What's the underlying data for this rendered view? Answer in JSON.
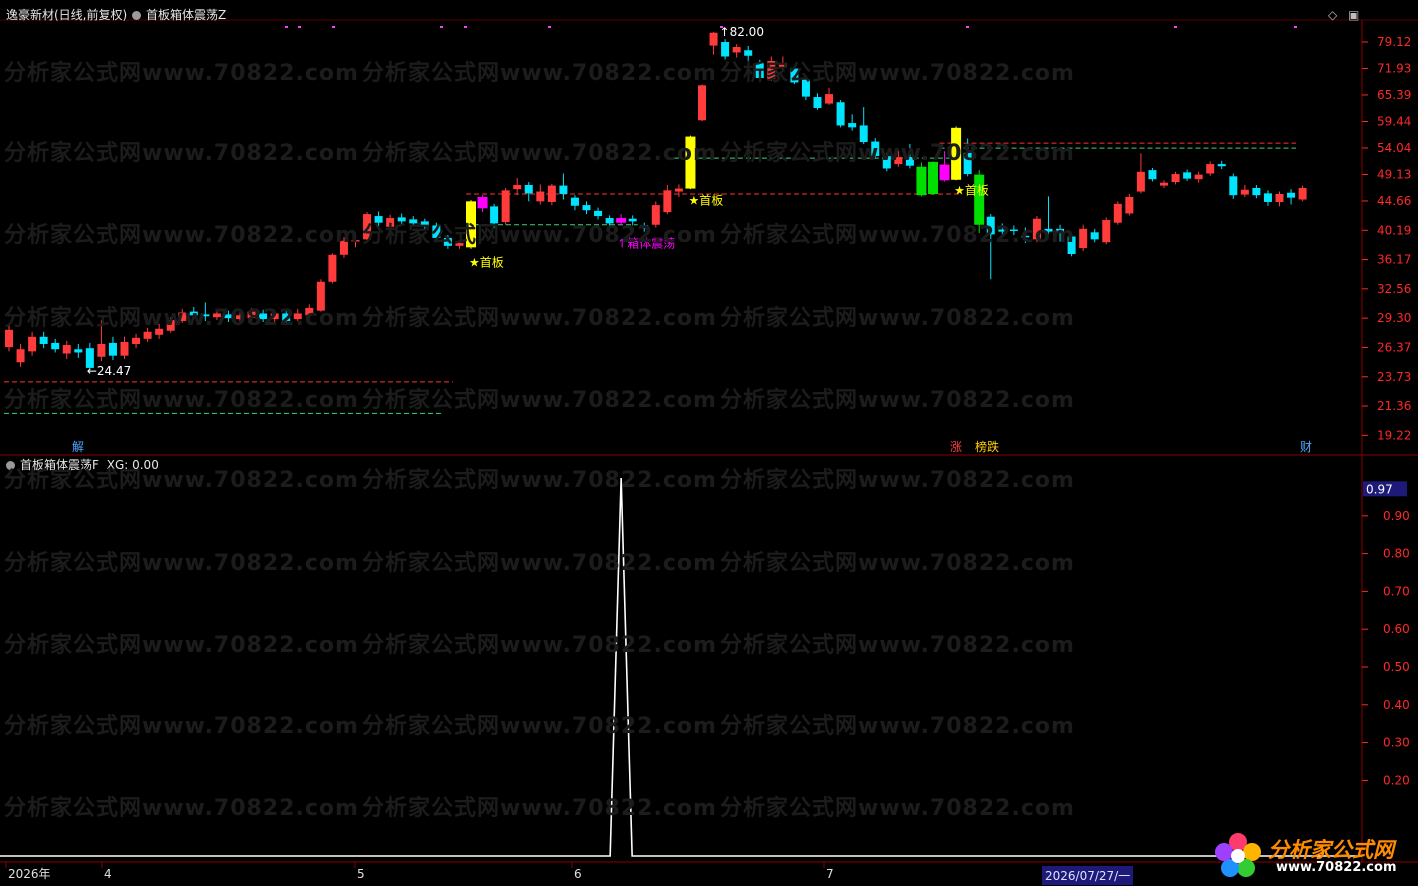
{
  "main_header": {
    "stock": "逸豪新材(日线,前复权)",
    "indicator": "首板箱体震荡Z"
  },
  "sub_header": {
    "indicator": "首板箱体震荡F",
    "xg_value": "XG: 0.00"
  },
  "window_controls": {
    "restore": "◇",
    "maximize": "▣"
  },
  "colors": {
    "up": "#ff3b3b",
    "down": "#00e5ff",
    "first_board": "#ffff00",
    "box_signal": "#ff00ff",
    "green_bar": "#00e000",
    "red_dash": "#ff3030",
    "green_dash": "#3cd37a",
    "axis_text": "#ff2828",
    "grid": "#600000"
  },
  "price_axis_labels": [
    "79.12",
    "71.93",
    "65.39",
    "59.44",
    "54.04",
    "49.13",
    "44.66",
    "40.19",
    "36.17",
    "32.56",
    "29.30",
    "26.37",
    "23.73",
    "21.36",
    "19.22"
  ],
  "sub_axis_labels": [
    "0.90",
    "0.80",
    "0.70",
    "0.60",
    "0.50",
    "0.40",
    "0.30",
    "0.20"
  ],
  "sub_axis_current": "0.97",
  "date_labels": [
    "2026年",
    "4",
    "5",
    "6",
    "7"
  ],
  "cursor_date": "2026/07/27/一",
  "annotations": {
    "high_price": "82.00",
    "low_price": "24.47",
    "first_board_1": "★首板",
    "first_board_2": "★首板",
    "first_board_3": "★首板",
    "box_osc": "箱体震荡"
  },
  "event_markers": {
    "jie": "解",
    "zhang": "涨",
    "bang_die": "榜跌",
    "cai": "财"
  },
  "watermark": "分析家公式网www.70822.com",
  "logo": {
    "title": "分析家公式网",
    "url": "www.70822.com"
  },
  "chart_data": {
    "type": "candlestick",
    "price_range": [
      19.22,
      82.0
    ],
    "candles": [
      {
        "o": 26.4,
        "c": 28.1,
        "h": 28.6,
        "l": 26.0
      },
      {
        "o": 25.0,
        "c": 26.2,
        "h": 26.7,
        "l": 24.6
      },
      {
        "o": 26.0,
        "c": 27.4,
        "h": 27.9,
        "l": 25.6
      },
      {
        "o": 27.4,
        "c": 26.7,
        "h": 27.9,
        "l": 26.3
      },
      {
        "o": 26.8,
        "c": 26.2,
        "h": 27.2,
        "l": 25.9
      },
      {
        "o": 25.8,
        "c": 26.6,
        "h": 27.0,
        "l": 25.3
      },
      {
        "o": 26.2,
        "c": 25.9,
        "h": 26.7,
        "l": 25.4
      },
      {
        "o": 26.3,
        "c": 24.5,
        "h": 26.8,
        "l": 24.3
      },
      {
        "o": 25.5,
        "c": 26.7,
        "h": 29.1,
        "l": 25.1
      },
      {
        "o": 26.8,
        "c": 25.6,
        "h": 27.4,
        "l": 25.2
      },
      {
        "o": 25.6,
        "c": 26.9,
        "h": 27.4,
        "l": 25.3
      },
      {
        "o": 26.7,
        "c": 27.3,
        "h": 27.7,
        "l": 26.3
      },
      {
        "o": 27.2,
        "c": 27.9,
        "h": 28.3,
        "l": 26.9
      },
      {
        "o": 27.6,
        "c": 28.2,
        "h": 28.7,
        "l": 27.2
      },
      {
        "o": 28.0,
        "c": 29.1,
        "h": 29.4,
        "l": 27.8
      },
      {
        "o": 29.0,
        "c": 29.9,
        "h": 30.3,
        "l": 28.8
      },
      {
        "o": 30.0,
        "c": 29.6,
        "h": 30.5,
        "l": 29.2
      },
      {
        "o": 29.7,
        "c": 29.5,
        "h": 31.0,
        "l": 29.0
      },
      {
        "o": 29.4,
        "c": 29.8,
        "h": 30.2,
        "l": 29.1
      },
      {
        "o": 29.7,
        "c": 29.3,
        "h": 30.1,
        "l": 28.9
      },
      {
        "o": 29.2,
        "c": 29.6,
        "h": 29.9,
        "l": 28.9
      },
      {
        "o": 29.3,
        "c": 30.0,
        "h": 30.4,
        "l": 29.0
      },
      {
        "o": 29.8,
        "c": 29.2,
        "h": 30.2,
        "l": 28.9
      },
      {
        "o": 29.2,
        "c": 29.8,
        "h": 30.2,
        "l": 28.9
      },
      {
        "o": 29.8,
        "c": 29.0,
        "h": 30.2,
        "l": 28.7
      },
      {
        "o": 29.2,
        "c": 29.8,
        "h": 30.3,
        "l": 29.0
      },
      {
        "o": 29.6,
        "c": 30.4,
        "h": 30.8,
        "l": 29.4
      },
      {
        "o": 30.1,
        "c": 33.4,
        "h": 33.7,
        "l": 30.0
      },
      {
        "o": 33.4,
        "c": 36.8,
        "h": 37.0,
        "l": 33.2
      },
      {
        "o": 36.8,
        "c": 38.7,
        "h": 39.2,
        "l": 36.4
      },
      {
        "o": 38.7,
        "c": 38.8,
        "h": 39.4,
        "l": 37.8
      },
      {
        "o": 38.9,
        "c": 42.6,
        "h": 42.9,
        "l": 38.6
      },
      {
        "o": 42.3,
        "c": 41.3,
        "h": 43.0,
        "l": 40.5
      },
      {
        "o": 40.7,
        "c": 42.0,
        "h": 42.5,
        "l": 40.3
      },
      {
        "o": 42.1,
        "c": 41.5,
        "h": 42.7,
        "l": 40.9
      },
      {
        "o": 41.8,
        "c": 41.2,
        "h": 42.3,
        "l": 40.8
      },
      {
        "o": 41.5,
        "c": 40.8,
        "h": 41.9,
        "l": 40.4
      },
      {
        "o": 40.9,
        "c": 39.1,
        "h": 41.3,
        "l": 38.7
      },
      {
        "o": 39.1,
        "c": 38.0,
        "h": 39.5,
        "l": 37.6
      },
      {
        "o": 38.0,
        "c": 38.4,
        "h": 38.8,
        "l": 37.6
      },
      {
        "o": 37.8,
        "c": 44.6,
        "h": 44.8,
        "l": 37.6
      },
      {
        "o": 43.5,
        "c": 45.3,
        "h": 45.6,
        "l": 42.9
      },
      {
        "o": 43.8,
        "c": 41.2,
        "h": 44.2,
        "l": 40.5
      },
      {
        "o": 41.4,
        "c": 46.4,
        "h": 46.8,
        "l": 41.0
      },
      {
        "o": 46.6,
        "c": 47.3,
        "h": 48.5,
        "l": 45.6
      },
      {
        "o": 47.3,
        "c": 45.9,
        "h": 47.8,
        "l": 44.6
      },
      {
        "o": 44.6,
        "c": 46.2,
        "h": 47.4,
        "l": 44.1
      },
      {
        "o": 44.5,
        "c": 47.2,
        "h": 47.5,
        "l": 44.0
      },
      {
        "o": 47.2,
        "c": 45.8,
        "h": 49.3,
        "l": 44.9
      },
      {
        "o": 45.2,
        "c": 43.9,
        "h": 45.6,
        "l": 43.2
      },
      {
        "o": 44.0,
        "c": 43.2,
        "h": 44.6,
        "l": 42.6
      },
      {
        "o": 43.1,
        "c": 42.3,
        "h": 43.6,
        "l": 41.8
      },
      {
        "o": 42.0,
        "c": 41.2,
        "h": 42.4,
        "l": 40.8
      },
      {
        "o": 41.3,
        "c": 42.0,
        "h": 42.6,
        "l": 40.9
      },
      {
        "o": 41.9,
        "c": 41.5,
        "h": 42.4,
        "l": 40.9
      },
      {
        "o": 40.9,
        "c": 40.5,
        "h": 41.3,
        "l": 40.0
      },
      {
        "o": 41.0,
        "c": 44.0,
        "h": 44.6,
        "l": 40.6
      },
      {
        "o": 42.9,
        "c": 46.4,
        "h": 47.3,
        "l": 42.6
      },
      {
        "o": 46.2,
        "c": 46.7,
        "h": 47.4,
        "l": 45.3
      },
      {
        "o": 46.7,
        "c": 56.3,
        "h": 56.5,
        "l": 46.6
      },
      {
        "o": 59.7,
        "c": 67.7,
        "h": 67.9,
        "l": 59.5
      },
      {
        "o": 78.1,
        "c": 81.8,
        "h": 82.0,
        "l": 75.6
      },
      {
        "o": 79.1,
        "c": 75.1,
        "h": 79.9,
        "l": 74.3
      },
      {
        "o": 76.2,
        "c": 77.7,
        "h": 78.5,
        "l": 74.8
      },
      {
        "o": 76.8,
        "c": 75.3,
        "h": 78.0,
        "l": 71.2
      },
      {
        "o": 73.3,
        "c": 69.5,
        "h": 74.2,
        "l": 68.8
      },
      {
        "o": 69.2,
        "c": 73.9,
        "h": 75.1,
        "l": 68.8
      },
      {
        "o": 72.3,
        "c": 73.4,
        "h": 75.1,
        "l": 71.4
      },
      {
        "o": 71.9,
        "c": 68.4,
        "h": 72.6,
        "l": 68.0
      },
      {
        "o": 69.1,
        "c": 65.0,
        "h": 69.4,
        "l": 64.2
      },
      {
        "o": 64.9,
        "c": 62.4,
        "h": 65.8,
        "l": 62.0
      },
      {
        "o": 63.4,
        "c": 65.6,
        "h": 67.1,
        "l": 63.1
      },
      {
        "o": 63.7,
        "c": 58.6,
        "h": 64.2,
        "l": 58.2
      },
      {
        "o": 59.1,
        "c": 58.2,
        "h": 61.0,
        "l": 57.5
      },
      {
        "o": 58.6,
        "c": 55.2,
        "h": 62.6,
        "l": 54.8
      },
      {
        "o": 55.3,
        "c": 52.5,
        "h": 56.0,
        "l": 52.0
      },
      {
        "o": 52.5,
        "c": 50.2,
        "h": 53.1,
        "l": 49.7
      },
      {
        "o": 51.0,
        "c": 52.3,
        "h": 53.5,
        "l": 50.5
      },
      {
        "o": 52.3,
        "c": 50.7,
        "h": 54.8,
        "l": 50.2
      },
      {
        "o": 50.5,
        "c": 45.6,
        "h": 51.3,
        "l": 45.4
      },
      {
        "o": 45.8,
        "c": 51.4,
        "h": 51.5,
        "l": 45.6
      },
      {
        "o": 50.9,
        "c": 48.1,
        "h": 53.4,
        "l": 47.9
      },
      {
        "o": 48.2,
        "c": 58.1,
        "h": 58.4,
        "l": 48.1
      },
      {
        "o": 53.1,
        "c": 49.2,
        "h": 55.9,
        "l": 48.8
      },
      {
        "o": 49.1,
        "c": 41.0,
        "h": 49.9,
        "l": 39.8
      },
      {
        "o": 42.2,
        "c": 39.6,
        "h": 42.6,
        "l": 33.7
      },
      {
        "o": 40.3,
        "c": 40.0,
        "h": 41.2,
        "l": 39.2
      },
      {
        "o": 40.3,
        "c": 40.1,
        "h": 40.9,
        "l": 39.5
      },
      {
        "o": 39.4,
        "c": 39.3,
        "h": 40.6,
        "l": 38.4
      },
      {
        "o": 38.9,
        "c": 41.9,
        "h": 42.3,
        "l": 38.5
      },
      {
        "o": 40.4,
        "c": 40.0,
        "h": 45.4,
        "l": 39.5
      },
      {
        "o": 40.4,
        "c": 40.0,
        "h": 41.0,
        "l": 38.6
      },
      {
        "o": 39.3,
        "c": 36.9,
        "h": 39.7,
        "l": 36.6
      },
      {
        "o": 37.7,
        "c": 40.4,
        "h": 41.0,
        "l": 37.3
      },
      {
        "o": 39.9,
        "c": 38.9,
        "h": 40.4,
        "l": 38.5
      },
      {
        "o": 38.5,
        "c": 41.7,
        "h": 42.1,
        "l": 38.2
      },
      {
        "o": 41.3,
        "c": 44.2,
        "h": 44.6,
        "l": 41.0
      },
      {
        "o": 42.7,
        "c": 45.3,
        "h": 45.8,
        "l": 42.4
      },
      {
        "o": 46.2,
        "c": 49.6,
        "h": 53.0,
        "l": 45.9
      },
      {
        "o": 49.9,
        "c": 48.3,
        "h": 50.3,
        "l": 47.9
      },
      {
        "o": 47.2,
        "c": 47.7,
        "h": 48.1,
        "l": 46.8
      },
      {
        "o": 47.8,
        "c": 49.2,
        "h": 49.6,
        "l": 47.4
      },
      {
        "o": 49.5,
        "c": 48.4,
        "h": 50.0,
        "l": 48.0
      },
      {
        "o": 48.3,
        "c": 49.1,
        "h": 49.6,
        "l": 47.7
      },
      {
        "o": 49.3,
        "c": 51.0,
        "h": 51.5,
        "l": 48.9
      },
      {
        "o": 51.0,
        "c": 50.6,
        "h": 51.6,
        "l": 50.1
      },
      {
        "o": 48.8,
        "c": 45.6,
        "h": 49.3,
        "l": 45.0
      },
      {
        "o": 45.7,
        "c": 46.5,
        "h": 47.3,
        "l": 45.3
      },
      {
        "o": 46.8,
        "c": 45.6,
        "h": 47.3,
        "l": 45.1
      },
      {
        "o": 45.9,
        "c": 44.5,
        "h": 46.4,
        "l": 43.9
      },
      {
        "o": 44.5,
        "c": 45.8,
        "h": 46.2,
        "l": 43.8
      },
      {
        "o": 46.0,
        "c": 45.2,
        "h": 46.6,
        "l": 44.1
      },
      {
        "o": 44.9,
        "c": 46.8,
        "h": 47.2,
        "l": 44.6
      }
    ],
    "special_bars": {
      "40": "first_board",
      "41": "box_signal",
      "53": "box_signal",
      "59": "first_board",
      "79": "green_bar",
      "80": "green_bar",
      "81": "box_signal",
      "82": "first_board",
      "84": "green_bar"
    },
    "levels": [
      {
        "price": 23.3,
        "color": "red",
        "from": 0,
        "to": 38
      },
      {
        "price": 20.8,
        "color": "green",
        "from": 0,
        "to": 37
      },
      {
        "price": 45.8,
        "color": "red",
        "from": 40,
        "to": 82
      },
      {
        "price": 41.0,
        "color": "green",
        "from": 40,
        "to": 54
      },
      {
        "price": 52.1,
        "color": "green",
        "from": 58,
        "to": 81
      },
      {
        "price": 55.0,
        "color": "red",
        "from": 81,
        "to": 111
      },
      {
        "price": 54.0,
        "color": "green",
        "from": 81,
        "to": 111
      }
    ],
    "sub_indicator": {
      "range": [
        0.0,
        1.0
      ],
      "spike_index": 53,
      "spike_value": 1.0
    }
  }
}
